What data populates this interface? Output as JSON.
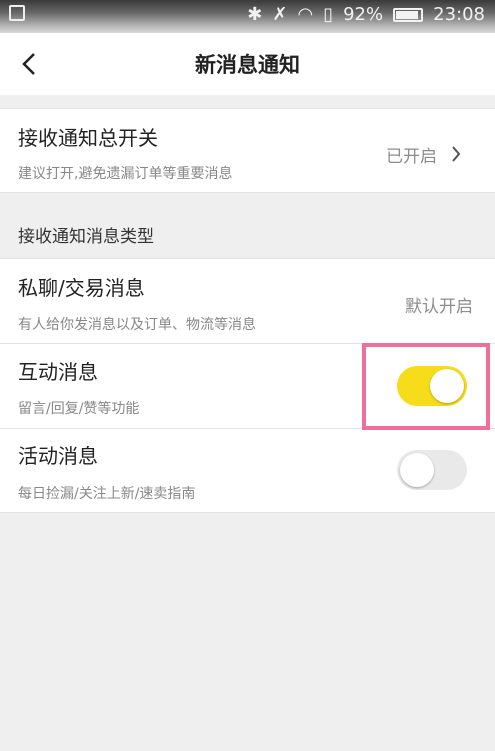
{
  "status_bar": {
    "battery": "92%",
    "time": "23:08"
  },
  "nav": {
    "title": "新消息通知"
  },
  "master": {
    "title": "接收通知总开关",
    "subtitle": "建议打开,避免遗漏订单等重要消息",
    "value": "已开启"
  },
  "section_label": "接收通知消息类型",
  "items": [
    {
      "title": "私聊/交易消息",
      "subtitle": "有人给你发消息以及订单、物流等消息",
      "value": "默认开启"
    },
    {
      "title": "互动消息",
      "subtitle": "留言/回复/赞等功能",
      "toggle": true
    },
    {
      "title": "活动消息",
      "subtitle": "每日捡漏/关注上新/速卖指南",
      "toggle": false
    }
  ],
  "colors": {
    "toggle_on": "#f7dc1b",
    "toggle_off": "#e9e9e9",
    "highlight": "#f06f98"
  }
}
